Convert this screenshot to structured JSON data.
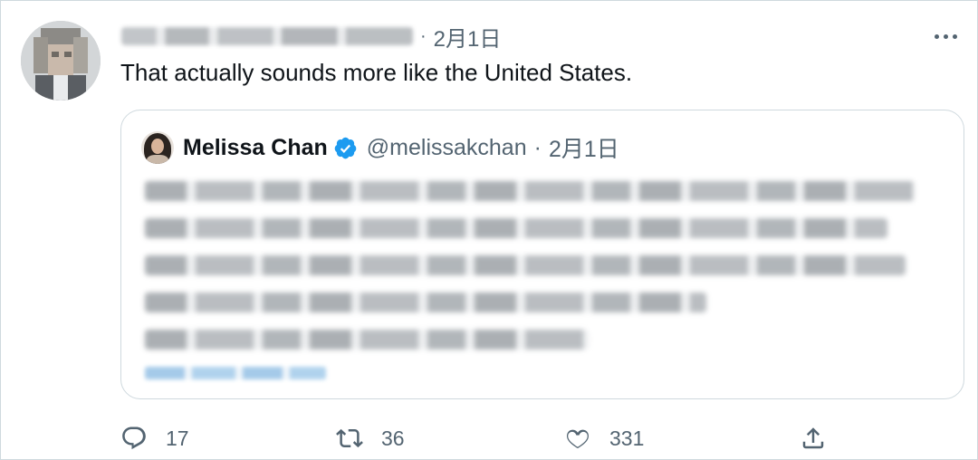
{
  "tweet": {
    "author_name_blurred": "",
    "separator": "·",
    "date": "2月1日",
    "text": "That actually sounds more like the United States."
  },
  "quoted_tweet": {
    "display_name": "Melissa Chan",
    "handle": "@melissakchan",
    "separator": "·",
    "date": "2月1日",
    "verified": true,
    "body_blurred": true
  },
  "actions": {
    "reply_count": "17",
    "retweet_count": "36",
    "like_count": "331"
  },
  "colors": {
    "text_primary": "#0f1419",
    "text_secondary": "#536471",
    "border": "#cfd9de",
    "verified_blue": "#1d9bf0"
  },
  "icons": [
    "more-icon",
    "verified-icon",
    "reply-icon",
    "retweet-icon",
    "like-icon",
    "share-icon"
  ]
}
